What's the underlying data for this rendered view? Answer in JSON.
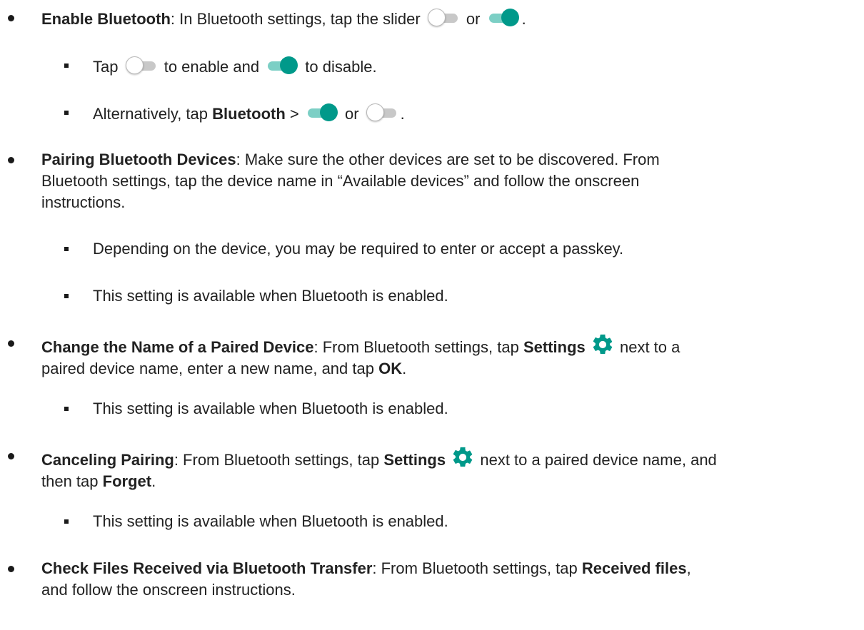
{
  "colors": {
    "toggle_on_knob": "#00998a",
    "toggle_on_track": "#7ccfc5",
    "toggle_off_track": "#c8c8c8",
    "gear": "#00998a"
  },
  "items": [
    {
      "title": "Enable Bluetooth",
      "t1": ": In Bluetooth settings, tap the slider ",
      "t2": " or ",
      "t3": ".",
      "subs": [
        {
          "t1": "Tap ",
          "t2": " to enable and ",
          "t3": " to disable."
        },
        {
          "t1": "Alternatively, tap ",
          "b1": "Bluetooth",
          "t2": " > ",
          "t3": " or ",
          "t4": "."
        }
      ]
    },
    {
      "title": "Pairing Bluetooth Devices",
      "line1": ": Make sure the other devices are set to be discovered. From",
      "line2": "Bluetooth settings, tap the device name in “Available devices” and follow the onscreen",
      "line3": "instructions.",
      "subs": [
        {
          "text": "Depending on the device, you may be required to enter or accept a passkey."
        },
        {
          "text": "This setting is available when Bluetooth is enabled."
        }
      ]
    },
    {
      "title": "Change the Name of a Paired Device",
      "t1": ": From Bluetooth settings, tap ",
      "b1": "Settings",
      "t2": " next to a",
      "line2": "paired device name, enter a new name, and tap ",
      "b2": "OK",
      "t3": ".",
      "subs": [
        {
          "text": "This setting is available when Bluetooth is enabled."
        }
      ]
    },
    {
      "title": "Canceling Pairing",
      "t1": ": From Bluetooth settings, tap ",
      "b1": "Settings",
      "t2": " next to a paired device name, and",
      "line2": "then tap ",
      "b2": "Forget",
      "t3": ".",
      "subs": [
        {
          "text": "This setting is available when Bluetooth is enabled."
        }
      ]
    },
    {
      "title": "Check Files Received via Bluetooth Transfer",
      "t1": ": From Bluetooth settings, tap ",
      "b1": "Received files",
      "t2": ",",
      "line2": "and follow the onscreen instructions."
    }
  ]
}
